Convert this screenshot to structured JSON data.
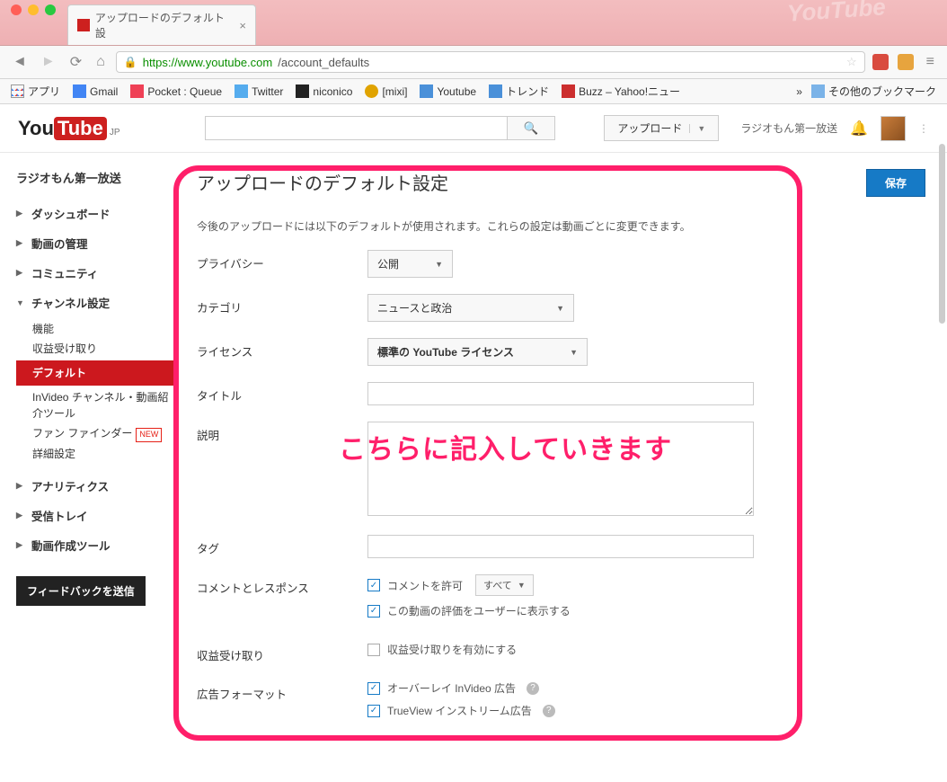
{
  "browser": {
    "tab_title": "アップロードのデフォルト設",
    "url_secure": "https://www.youtube.com",
    "url_path": "/account_defaults",
    "watermark": "YouTube"
  },
  "bookmarks": {
    "apps": "アプリ",
    "gmail": "Gmail",
    "pocket": "Pocket : Queue",
    "twitter": "Twitter",
    "niconico": "niconico",
    "mixi": "[mixi]",
    "youtube": "Youtube",
    "trend": "トレンド",
    "buzz": "Buzz – Yahoo!ニュー",
    "more": "»",
    "other": "その他のブックマーク"
  },
  "header": {
    "logo_you": "You",
    "logo_tube": "Tube",
    "logo_jp": "JP",
    "upload": "アップロード",
    "username": "ラジオもん第一放送"
  },
  "sidebar": {
    "title": "ラジオもん第一放送",
    "dashboard": "ダッシュボード",
    "video_manager": "動画の管理",
    "community": "コミュニティ",
    "channel_settings": "チャンネル設定",
    "sub_features": "機能",
    "sub_monetization": "収益受け取り",
    "sub_defaults": "デフォルト",
    "sub_invideo": "InVideo チャンネル・動画紹介ツール",
    "sub_fanfinder": "ファン ファインダー",
    "sub_fanfinder_new": "NEW",
    "sub_advanced": "詳細設定",
    "analytics": "アナリティクス",
    "inbox": "受信トレイ",
    "video_tools": "動画作成ツール",
    "feedback": "フィードバックを送信"
  },
  "page": {
    "title": "アップロードのデフォルト設定",
    "save": "保存",
    "description": "今後のアップロードには以下のデフォルトが使用されます。これらの設定は動画ごとに変更できます。"
  },
  "form": {
    "privacy_label": "プライバシー",
    "privacy_value": "公開",
    "category_label": "カテゴリ",
    "category_value": "ニュースと政治",
    "license_label": "ライセンス",
    "license_value": "標準の YouTube ライセンス",
    "title_label": "タイトル",
    "desc_label": "説明",
    "tags_label": "タグ",
    "comments_label": "コメントとレスポンス",
    "allow_comments": "コメントを許可",
    "comments_filter": "すべて",
    "show_ratings": "この動画の評価をユーザーに表示する",
    "monetization_label": "収益受け取り",
    "monetize_enable": "収益受け取りを有効にする",
    "adformat_label": "広告フォーマット",
    "overlay_ad": "オーバーレイ InVideo 広告",
    "trueview_ad": "TrueView インストリーム広告"
  },
  "annotation": "こちらに記入していきます"
}
